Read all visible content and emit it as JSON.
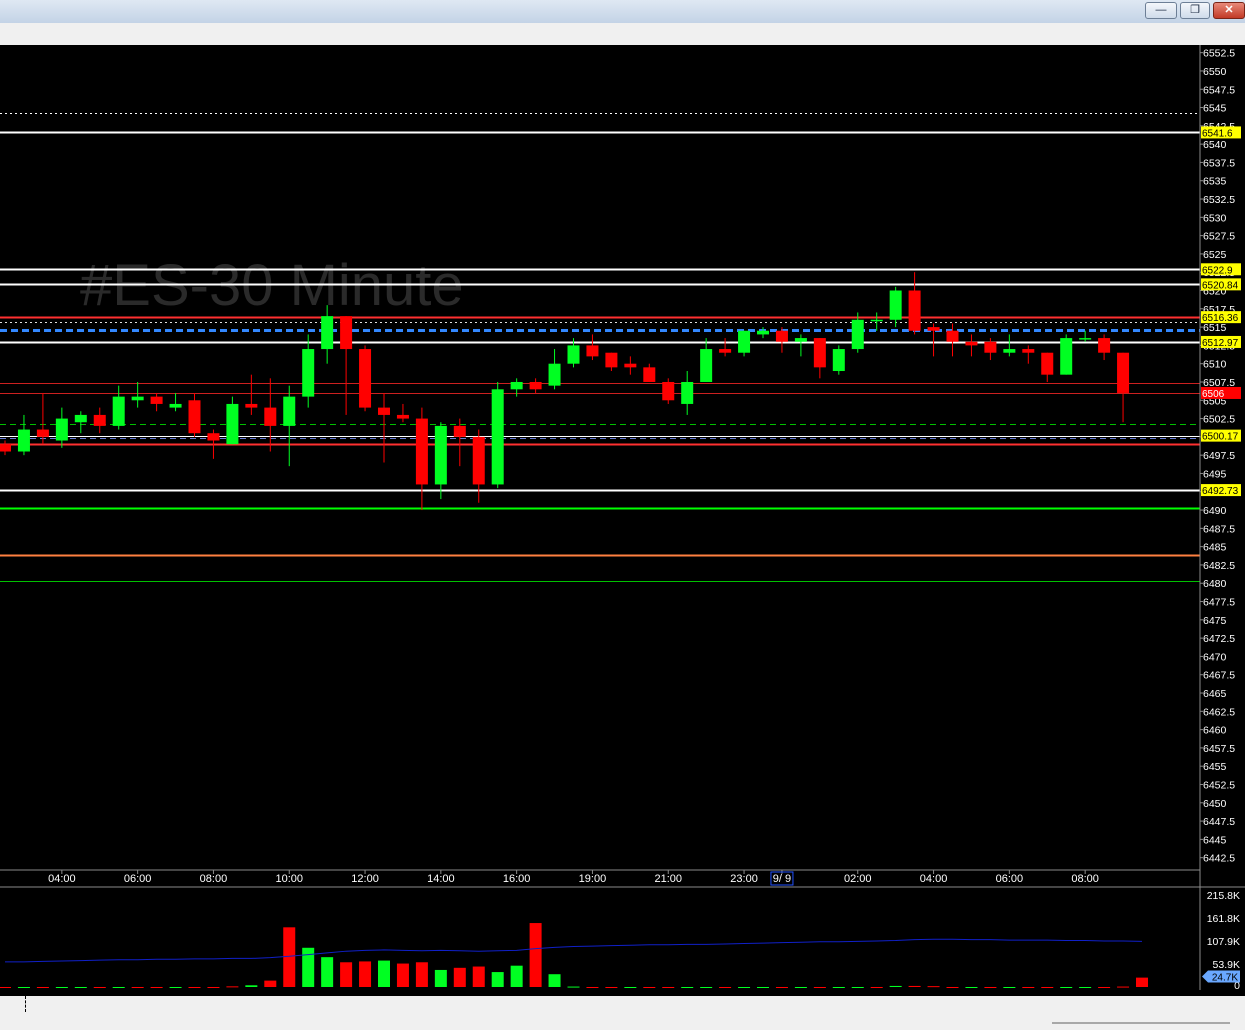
{
  "window": {
    "minimize_glyph": "—",
    "restore_glyph": "❐",
    "close_glyph": "✕"
  },
  "watermark": "#ES-30 Minute",
  "colors": {
    "background": "#000000",
    "up": "#00ff22",
    "down": "#ff0000",
    "axis_text": "#ffffff",
    "volume_avg": "#1020c8"
  },
  "chart_data": [
    {
      "type": "candlestick",
      "symbol": "#ES",
      "timeframe": "30 Minute",
      "y_ticks": [
        "6552.5",
        "6550",
        "6547.5",
        "6545",
        "6542.5",
        "6540",
        "6537.5",
        "6535",
        "6532.5",
        "6530",
        "6527.5",
        "6525",
        "6522.5",
        "6520",
        "6517.5",
        "6515",
        "6512.5",
        "6510",
        "6507.5",
        "6505",
        "6502.5",
        "6500",
        "6497.5",
        "6495",
        "6492.5",
        "6490",
        "6487.5",
        "6485",
        "6482.5",
        "6480",
        "6477.5",
        "6475",
        "6472.5",
        "6470",
        "6467.5",
        "6465",
        "6462.5",
        "6460",
        "6457.5",
        "6455",
        "6452.5",
        "6450",
        "6447.5",
        "6445",
        "6442.5"
      ],
      "ylim": [
        6441.5,
        6553
      ],
      "x_labels": [
        {
          "label": "04:00",
          "bar": 3
        },
        {
          "label": "06:00",
          "bar": 7
        },
        {
          "label": "08:00",
          "bar": 11
        },
        {
          "label": "10:00",
          "bar": 15
        },
        {
          "label": "12:00",
          "bar": 19
        },
        {
          "label": "14:00",
          "bar": 23
        },
        {
          "label": "16:00",
          "bar": 27
        },
        {
          "label": "19:00",
          "bar": 31
        },
        {
          "label": "21:00",
          "bar": 35
        },
        {
          "label": "23:00",
          "bar": 39
        },
        {
          "label": "9/ 9",
          "bar": 41
        },
        {
          "label": "02:00",
          "bar": 45
        },
        {
          "label": "04:00",
          "bar": 49
        },
        {
          "label": "06:00",
          "bar": 53
        },
        {
          "label": "08:00",
          "bar": 57
        }
      ],
      "candles": [
        {
          "o": 6499,
          "h": 6499.5,
          "l": 6497.5,
          "c": 6498
        },
        {
          "o": 6498,
          "h": 6503,
          "l": 6497.5,
          "c": 6501
        },
        {
          "o": 6501,
          "h": 6506,
          "l": 6499,
          "c": 6500
        },
        {
          "o": 6499.5,
          "h": 6504,
          "l": 6498.5,
          "c": 6502.5
        },
        {
          "o": 6502,
          "h": 6503.5,
          "l": 6500.5,
          "c": 6503
        },
        {
          "o": 6503,
          "h": 6504,
          "l": 6500.5,
          "c": 6501.5
        },
        {
          "o": 6501.5,
          "h": 6507,
          "l": 6501,
          "c": 6505.5
        },
        {
          "o": 6505,
          "h": 6507.5,
          "l": 6504,
          "c": 6505.5
        },
        {
          "o": 6505.5,
          "h": 6506,
          "l": 6503.5,
          "c": 6504.5
        },
        {
          "o": 6504,
          "h": 6506,
          "l": 6503.5,
          "c": 6504.5
        },
        {
          "o": 6505,
          "h": 6506,
          "l": 6500,
          "c": 6500.5
        },
        {
          "o": 6500.5,
          "h": 6501,
          "l": 6497,
          "c": 6499.5
        },
        {
          "o": 6499,
          "h": 6505.5,
          "l": 6499,
          "c": 6504.5
        },
        {
          "o": 6504.5,
          "h": 6508.5,
          "l": 6503,
          "c": 6504
        },
        {
          "o": 6504,
          "h": 6508,
          "l": 6498,
          "c": 6501.5
        },
        {
          "o": 6501.5,
          "h": 6507,
          "l": 6496,
          "c": 6505.5
        },
        {
          "o": 6505.5,
          "h": 6514,
          "l": 6504,
          "c": 6512
        },
        {
          "o": 6512,
          "h": 6518,
          "l": 6510,
          "c": 6516.5
        },
        {
          "o": 6516.5,
          "h": 6516.5,
          "l": 6503,
          "c": 6512
        },
        {
          "o": 6512,
          "h": 6512.5,
          "l": 6503.5,
          "c": 6504
        },
        {
          "o": 6504,
          "h": 6506,
          "l": 6496.5,
          "c": 6503
        },
        {
          "o": 6503,
          "h": 6504.5,
          "l": 6502,
          "c": 6502.5
        },
        {
          "o": 6502.5,
          "h": 6504,
          "l": 6490,
          "c": 6493.5
        },
        {
          "o": 6493.5,
          "h": 6502,
          "l": 6491.5,
          "c": 6501.5
        },
        {
          "o": 6501.5,
          "h": 6502.5,
          "l": 6496,
          "c": 6500
        },
        {
          "o": 6500,
          "h": 6501,
          "l": 6491,
          "c": 6493.5
        },
        {
          "o": 6493.5,
          "h": 6507.5,
          "l": 6493,
          "c": 6506.5
        },
        {
          "o": 6506.5,
          "h": 6508,
          "l": 6505.5,
          "c": 6507.5
        },
        {
          "o": 6507.5,
          "h": 6508,
          "l": 6506,
          "c": 6506.5
        },
        {
          "o": 6507,
          "h": 6512,
          "l": 6506.5,
          "c": 6510
        },
        {
          "o": 6510,
          "h": 6513.5,
          "l": 6509.5,
          "c": 6512.5
        },
        {
          "o": 6512.5,
          "h": 6514,
          "l": 6510.5,
          "c": 6511
        },
        {
          "o": 6511.5,
          "h": 6511.5,
          "l": 6509,
          "c": 6509.5
        },
        {
          "o": 6510,
          "h": 6511,
          "l": 6508.5,
          "c": 6509.5
        },
        {
          "o": 6509.5,
          "h": 6510,
          "l": 6507.5,
          "c": 6507.5
        },
        {
          "o": 6507.5,
          "h": 6508,
          "l": 6504.5,
          "c": 6505
        },
        {
          "o": 6504.5,
          "h": 6509,
          "l": 6503,
          "c": 6507.5
        },
        {
          "o": 6507.5,
          "h": 6513.5,
          "l": 6507.5,
          "c": 6512
        },
        {
          "o": 6512,
          "h": 6513.5,
          "l": 6511,
          "c": 6511.5
        },
        {
          "o": 6511.5,
          "h": 6514.5,
          "l": 6511,
          "c": 6514.5
        },
        {
          "o": 6514,
          "h": 6515,
          "l": 6513.5,
          "c": 6514.5
        },
        {
          "o": 6514.5,
          "h": 6515,
          "l": 6511.5,
          "c": 6513
        },
        {
          "o": 6513,
          "h": 6514,
          "l": 6511,
          "c": 6513.5
        },
        {
          "o": 6513.5,
          "h": 6513.5,
          "l": 6508,
          "c": 6509.5
        },
        {
          "o": 6509,
          "h": 6512.5,
          "l": 6508.5,
          "c": 6512
        },
        {
          "o": 6512,
          "h": 6517,
          "l": 6511.5,
          "c": 6516
        },
        {
          "o": 6516,
          "h": 6517,
          "l": 6514.5,
          "c": 6516
        },
        {
          "o": 6516,
          "h": 6520.5,
          "l": 6515,
          "c": 6520
        },
        {
          "o": 6520,
          "h": 6522.5,
          "l": 6514,
          "c": 6514.5
        },
        {
          "o": 6515,
          "h": 6515.5,
          "l": 6511,
          "c": 6514.5
        },
        {
          "o": 6514.5,
          "h": 6515.5,
          "l": 6511,
          "c": 6513
        },
        {
          "o": 6513,
          "h": 6514,
          "l": 6511,
          "c": 6512.5
        },
        {
          "o": 6513,
          "h": 6513.5,
          "l": 6510.5,
          "c": 6511.5
        },
        {
          "o": 6511.5,
          "h": 6514,
          "l": 6511,
          "c": 6512
        },
        {
          "o": 6512,
          "h": 6512.5,
          "l": 6510,
          "c": 6511.5
        },
        {
          "o": 6511.5,
          "h": 6511.5,
          "l": 6507.5,
          "c": 6508.5
        },
        {
          "o": 6508.5,
          "h": 6514,
          "l": 6508.5,
          "c": 6513.5
        },
        {
          "o": 6513.5,
          "h": 6514.5,
          "l": 6513,
          "c": 6513.5
        },
        {
          "o": 6513.5,
          "h": 6514,
          "l": 6510.5,
          "c": 6511.5
        },
        {
          "o": 6511.5,
          "h": 6511.5,
          "l": 6502,
          "c": 6506
        }
      ],
      "horizontal_lines": [
        {
          "price": 6544.2,
          "color": "#ffffff",
          "style": "dotted",
          "width": 1
        },
        {
          "price": 6541.6,
          "color": "#ffffff",
          "style": "solid",
          "width": 2,
          "label": "6541.6",
          "label_bg": "#ffff00",
          "label_fg": "#000000"
        },
        {
          "price": 6522.9,
          "color": "#ffffff",
          "style": "solid",
          "width": 2,
          "label": "6522.9",
          "label_bg": "#ffff00",
          "label_fg": "#000000"
        },
        {
          "price": 6520.84,
          "color": "#ffffff",
          "style": "solid",
          "width": 2,
          "label": "6520.84",
          "label_bg": "#ffff00",
          "label_fg": "#000000"
        },
        {
          "price": 6516.36,
          "color": "#ff3030",
          "style": "solid",
          "width": 2,
          "label": "6516.36",
          "label_bg": "#ffff00",
          "label_fg": "#000000"
        },
        {
          "price": 6515.7,
          "color": "#e0e0e0",
          "style": "dotted",
          "width": 1
        },
        {
          "price": 6514.6,
          "color": "#3388ff",
          "style": "dashed",
          "width": 3
        },
        {
          "price": 6512.97,
          "color": "#ffffff",
          "style": "solid",
          "width": 2,
          "label": "6512.97",
          "label_bg": "#ffff00",
          "label_fg": "#000000"
        },
        {
          "price": 6507.4,
          "color": "#cc2020",
          "style": "solid",
          "width": 1
        },
        {
          "price": 6506,
          "color": "#cc2020",
          "style": "solid",
          "width": 1,
          "label": "6506",
          "label_bg": "#ff0000",
          "label_fg": "#ffffff"
        },
        {
          "price": 6501.7,
          "color": "#00c000",
          "style": "dashed",
          "width": 1
        },
        {
          "price": 6500.17,
          "color": "#ffffff",
          "style": "solid",
          "width": 1,
          "label": "6500.17",
          "label_bg": "#ffff00",
          "label_fg": "#000000"
        },
        {
          "price": 6499.8,
          "color": "#6a7fd8",
          "style": "dashed",
          "width": 1
        },
        {
          "price": 6499,
          "color": "#ff3030",
          "style": "solid",
          "width": 2
        },
        {
          "price": 6492.73,
          "color": "#ffffff",
          "style": "solid",
          "width": 2,
          "label": "6492.73",
          "label_bg": "#ffff00",
          "label_fg": "#000000"
        },
        {
          "price": 6490.3,
          "color": "#00ff00",
          "style": "solid",
          "width": 2
        },
        {
          "price": 6483.9,
          "color": "#ff8040",
          "style": "solid",
          "width": 2
        },
        {
          "price": 6480.3,
          "color": "#00c000",
          "style": "solid",
          "width": 1
        }
      ]
    },
    {
      "type": "bar",
      "title": "Volume",
      "y_ticks": [
        "215.8K",
        "161.8K",
        "107.9K",
        "53.9K",
        "0"
      ],
      "ylim": [
        0,
        215800
      ],
      "current_label": "24.7K",
      "values": [
        0,
        0,
        0,
        0,
        0,
        0,
        0,
        0,
        0,
        0,
        0,
        0,
        1500,
        4000,
        15000,
        140000,
        92000,
        70000,
        58000,
        60000,
        62000,
        55000,
        58000,
        40000,
        45000,
        48000,
        35000,
        50000,
        150000,
        30000,
        1000,
        0,
        0,
        0,
        0,
        0,
        0,
        0,
        0,
        0,
        0,
        0,
        0,
        0,
        0,
        0,
        0,
        2500,
        2500,
        2000,
        0,
        0,
        0,
        0,
        0,
        0,
        0,
        0,
        0,
        1000,
        22000
      ],
      "directions": [
        "down",
        "up",
        "down",
        "up",
        "up",
        "down",
        "up",
        "down",
        "down",
        "up",
        "down",
        "down",
        "down",
        "up",
        "down",
        "down",
        "up",
        "up",
        "down",
        "down",
        "up",
        "down",
        "down",
        "up",
        "down",
        "down",
        "up",
        "up",
        "down",
        "up",
        "up",
        "down",
        "down",
        "up",
        "down",
        "down",
        "up",
        "up",
        "down",
        "up",
        "up",
        "down",
        "up",
        "down",
        "up",
        "up",
        "down",
        "up",
        "down",
        "down",
        "down",
        "up",
        "down",
        "up",
        "down",
        "down",
        "up",
        "up",
        "down",
        "down",
        "down"
      ],
      "average": [
        59000,
        59000,
        60000,
        61000,
        62000,
        63000,
        64000,
        64000,
        65000,
        65000,
        66000,
        66000,
        67000,
        67000,
        69000,
        72000,
        76000,
        80000,
        84000,
        86000,
        87000,
        86000,
        85000,
        86000,
        85000,
        84000,
        85000,
        86000,
        90000,
        93000,
        95000,
        96000,
        97000,
        98000,
        99000,
        99000,
        100000,
        100000,
        101000,
        102000,
        103000,
        104000,
        105000,
        106000,
        106000,
        107000,
        108000,
        109000,
        111000,
        112000,
        112000,
        111000,
        111000,
        110000,
        110000,
        110000,
        109000,
        109000,
        108000,
        108000,
        107000
      ]
    }
  ]
}
